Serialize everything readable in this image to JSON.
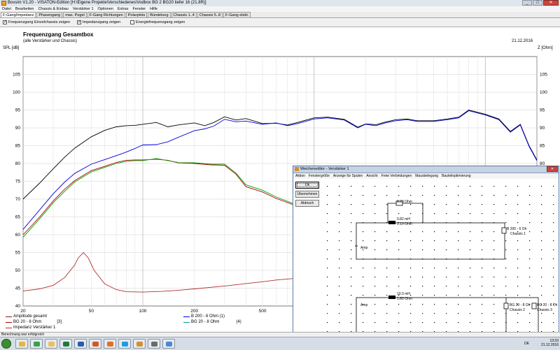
{
  "window": {
    "title": "Boxsim V1.20 - VISATON-Edition [H:\\Eigene Projekte\\Verschiedenes\\Vodbox BG 2 BG20 tiefer 16 (21.8R)]",
    "buttons": {
      "minimize": "_",
      "maximize": "□",
      "close": "✕"
    }
  },
  "menu": [
    "Datei",
    "Bearbeiten",
    "Chassis & Einbau",
    "Verstärker 1",
    "Optionen",
    "Extras",
    "Fenster",
    "Hilfe"
  ],
  "tabs": [
    {
      "label": "F-Gang/Impedanz",
      "active": true
    },
    {
      "label": "Phasengang",
      "active": false
    },
    {
      "label": "max. Pegel",
      "active": false
    },
    {
      "label": "F-Gang Richtungen",
      "active": false
    },
    {
      "label": "Polarplots",
      "active": false
    },
    {
      "label": "Bündelung",
      "active": false
    },
    {
      "label": "Chassis 1..4",
      "active": false
    },
    {
      "label": "Chassis 5..8",
      "active": false
    },
    {
      "label": "F-Gang elekt.",
      "active": false
    }
  ],
  "checkboxes": [
    {
      "label": "Frequenzgang Einzelchassis zeigen",
      "checked": true
    },
    {
      "label": "Impedanzgang zeigen",
      "checked": true
    },
    {
      "label": "Energiefrequenzgang zeigen",
      "checked": false
    }
  ],
  "plot": {
    "title": "Frequenzgang Gesamtbox",
    "subtitle": "(alle Verstärker und Chassis)",
    "date": "21.12.2016",
    "ylabel_left": "SPL [dB]",
    "ylabel_right": "Z [Ohm]"
  },
  "chart_data": {
    "type": "line",
    "title": "Frequenzgang Gesamtbox",
    "subtitle": "(alle Verstärker und Chassis)",
    "xlabel": "",
    "ylabel": "SPL [dB]",
    "y2label": "Z [Ohm]",
    "xscale": "log",
    "xlim": [
      20,
      20000
    ],
    "xticks": [
      20,
      50,
      100,
      200,
      500
    ],
    "ylim": [
      40,
      110
    ],
    "yticks": [
      40,
      45,
      50,
      55,
      60,
      65,
      70,
      75,
      80,
      85,
      90,
      95,
      100,
      105
    ],
    "y2ticks": [
      40,
      45,
      50,
      55,
      60,
      65,
      70,
      75,
      80,
      85,
      90,
      95,
      100,
      105
    ],
    "grid": true,
    "series": [
      {
        "name": "Amplitude gesamt",
        "color": "#000000",
        "x": [
          20,
          25,
          30,
          35,
          40,
          50,
          60,
          70,
          80,
          90,
          100,
          120,
          140,
          160,
          200,
          230,
          260,
          300,
          350,
          400,
          500,
          600,
          700,
          800,
          1000,
          1200,
          1500,
          1800,
          2000,
          2300,
          2600,
          3000,
          3500,
          4000,
          5000,
          6000,
          7000,
          8000,
          10000,
          12000,
          14000,
          16000,
          18000,
          20000
        ],
        "y": [
          70,
          74.5,
          78.5,
          81.8,
          84.3,
          87.5,
          89.3,
          90.3,
          90.6,
          90.7,
          91,
          91.5,
          90.3,
          90.8,
          91.4,
          90.6,
          91.5,
          93.1,
          92.2,
          92.6,
          91.2,
          91.3,
          90.8,
          91.5,
          92.8,
          93,
          92.4,
          90.2,
          91.1,
          90.9,
          91.6,
          92.3,
          92.5,
          92,
          92,
          92.5,
          93,
          95,
          93.8,
          92.5,
          89,
          91,
          85,
          81
        ]
      },
      {
        "name": "B 200 - 6 Ohm",
        "color": "#0000dd",
        "x": [
          20,
          25,
          30,
          35,
          40,
          50,
          60,
          70,
          80,
          90,
          100,
          120,
          140,
          160,
          200,
          230,
          260,
          300,
          350,
          400,
          500,
          600,
          700,
          800,
          1000,
          1200,
          1500,
          1800,
          2000,
          2300,
          2600,
          3000,
          3500,
          4000,
          5000,
          6000,
          7000,
          8000,
          10000,
          12000,
          14000,
          16000,
          18000,
          20000
        ],
        "y": [
          61.5,
          67,
          71.5,
          74.8,
          77.2,
          79.8,
          81.1,
          82.2,
          83.2,
          84.2,
          85.2,
          85.3,
          86.1,
          87.3,
          89.2,
          89.7,
          90.5,
          92.4,
          91.7,
          91.9,
          91,
          91.4,
          90.6,
          91.2,
          92.5,
          92.8,
          92.2,
          90,
          91,
          90.6,
          91.4,
          92,
          92.3,
          91.8,
          91.8,
          92.3,
          92.8,
          94.8,
          93.6,
          92.3,
          88.8,
          90.8,
          84.8,
          80.8
        ]
      },
      {
        "name": "BG 20 - 8 Ohm",
        "color": "#b00000",
        "x": [
          20,
          25,
          30,
          35,
          40,
          50,
          60,
          70,
          80,
          90,
          100,
          120,
          140,
          160,
          200,
          250,
          300,
          350,
          400,
          500,
          600,
          800
        ],
        "y": [
          60,
          65,
          69.5,
          72.8,
          75.2,
          78,
          79.2,
          80.3,
          80.9,
          81,
          81,
          81.2,
          80.9,
          80.2,
          80,
          79.6,
          79.5,
          77,
          73.5,
          72,
          70.2,
          68
        ]
      },
      {
        "name": "BG 20 - 8 Ohm",
        "color": "#00a000",
        "x": [
          20,
          25,
          30,
          35,
          40,
          50,
          60,
          70,
          80,
          90,
          100,
          120,
          140,
          160,
          200,
          250,
          300,
          350,
          400,
          500,
          600,
          800
        ],
        "y": [
          59.3,
          64.5,
          69,
          72.2,
          74.8,
          77.6,
          78.9,
          80,
          80.6,
          80.8,
          80.8,
          81.4,
          80.8,
          80.3,
          80.2,
          79.8,
          79.8,
          77.3,
          74,
          72.5,
          70.6,
          68.3
        ]
      },
      {
        "name": "Impedanz Verstärker 1",
        "color": "#b03030",
        "x": [
          20,
          25,
          30,
          35,
          40,
          42,
          45,
          48,
          52,
          60,
          70,
          80,
          100,
          130,
          160,
          200,
          300,
          400,
          500,
          600,
          800
        ],
        "y": [
          44.2,
          44.8,
          45.8,
          48,
          51.5,
          53.5,
          55,
          53.5,
          50,
          46.2,
          44.6,
          44,
          43.9,
          44.1,
          44.4,
          44.8,
          45.6,
          46.3,
          46.8,
          47.3,
          47.8
        ]
      }
    ]
  },
  "legend": [
    {
      "label": "Amplitude gesamt",
      "color": "#8b1a1a",
      "suffix": ""
    },
    {
      "label": "BG 20 - 8 Ohm",
      "color": "#b00000",
      "suffix": "[3]"
    },
    {
      "label": "Impedanz Verstärker 1",
      "color": "#b03030",
      "suffix": ""
    },
    {
      "label": "B 200 - 6 Ohm (1)",
      "color": "#0000dd",
      "suffix": ""
    },
    {
      "label": "BG 20 - 8 Ohm",
      "color": "#00a0a0",
      "suffix": "(4)"
    }
  ],
  "status": "Berechnung war erfolgreich",
  "taskbar": {
    "time": "13:33",
    "date": "21.12.2016",
    "lang": "DE",
    "apps": [
      {
        "name": "explorer",
        "color": "#e0b840"
      },
      {
        "name": "chrome",
        "color": "#3aa04a"
      },
      {
        "name": "folder",
        "color": "#e8c060"
      },
      {
        "name": "excel",
        "color": "#1f7a3a"
      },
      {
        "name": "word",
        "color": "#2a5caa"
      },
      {
        "name": "powerpoint",
        "color": "#d05a20"
      },
      {
        "name": "firefox",
        "color": "#e07020"
      },
      {
        "name": "skype",
        "color": "#1a9ee0"
      },
      {
        "name": "boxsim",
        "color": "#d49030"
      },
      {
        "name": "app",
        "color": "#6a6a6a"
      },
      {
        "name": "app2",
        "color": "#4a8ad0"
      }
    ]
  },
  "weichen": {
    "title": "Weicheneditor - Verstärker 1",
    "menu": [
      "Aktion",
      "Fenstergröße",
      "Anzeige für Spulen",
      "Ansicht",
      "Freie Verbindungen",
      "Mausbelegung",
      "Bauteiloptimierung"
    ],
    "buttons": [
      "Ok",
      "Übernehmen",
      "Abbruch"
    ],
    "components": {
      "r1": "8.20 Ohm",
      "l1a": "0.82 mH",
      "l1b": "1.10 Ohm",
      "chassis1a": "B 200 - 6 Oh",
      "chassis1b": "Chassis 1",
      "amp1": "Amp",
      "l2a": "10.0 mH",
      "l2b": "1.80 Ohm",
      "amp2": "Amp",
      "chassis2a": "BG 20 - 8 Oh",
      "chassis2b": "Chassis 2",
      "chassis3a": "BG 20 - 8 Oh",
      "chassis3b": "Chassis 3"
    }
  }
}
